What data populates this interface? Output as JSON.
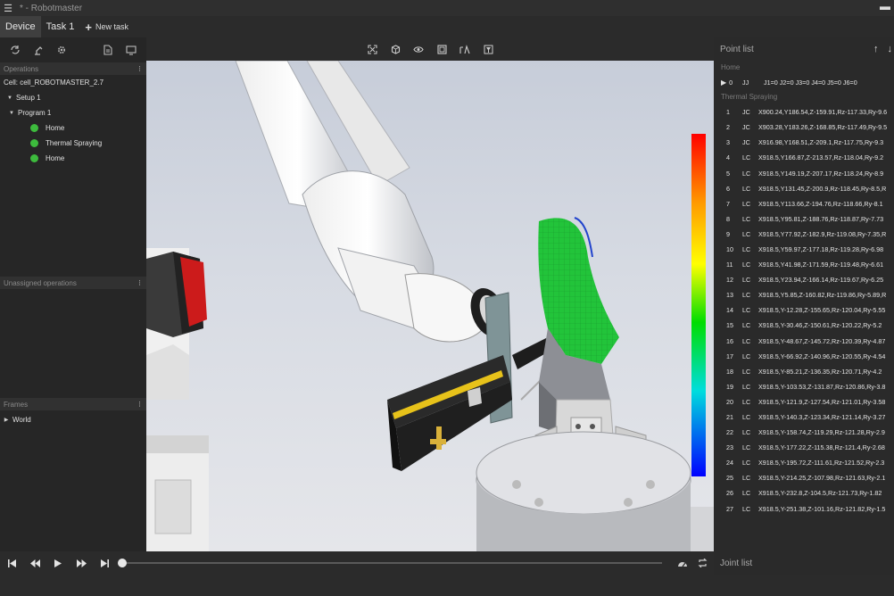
{
  "window": {
    "title": "* - Robotmaster",
    "menu_icon": "hamburger-icon"
  },
  "tabs": [
    {
      "label": "Device",
      "active": true
    },
    {
      "label": "Task 1",
      "active": false
    },
    {
      "label": "New task",
      "icon": "plus-icon",
      "active": false
    }
  ],
  "left_panel": {
    "toolbar_icons": [
      "cycle-icon",
      "robot-arm-icon",
      "gear-icon",
      "document-icon",
      "monitor-icon"
    ],
    "operations": {
      "header": "Operations",
      "cell": "Cell: cell_ROBOTMASTER_2.7",
      "setup": "Setup 1",
      "program": "Program 1",
      "items": [
        {
          "label": "Home",
          "status_color": "#3dbb3d"
        },
        {
          "label": "Thermal Spraying",
          "status_color": "#3dbb3d"
        },
        {
          "label": "Home",
          "status_color": "#3dbb3d"
        }
      ]
    },
    "unassigned": {
      "header": "Unassigned operations"
    },
    "frames": {
      "header": "Frames",
      "items": [
        "World"
      ]
    }
  },
  "viewport_toolbar": [
    "fit-view-icon",
    "cube-view-icon",
    "visibility-icon",
    "frame-icon",
    "path-icon",
    "filter-icon"
  ],
  "colors": {
    "gradient_top": "#ff0000",
    "gradient_bottom": "#0000ff",
    "status_green": "#3dbb3d",
    "panel_bg": "#2a2a2a"
  },
  "point_list": {
    "header": "Point list",
    "home_group": "Home",
    "home_point": {
      "num": "0",
      "type": "JJ",
      "coords": "J1=0 J2=0 J3=0 J4=0 J5=0 J6=0"
    },
    "spray_group": "Thermal Spraying",
    "points": [
      {
        "num": "1",
        "type": "JC",
        "coords": "X900.24,Y186.54,Z-159.91,Rz-117.33,Ry-9.6"
      },
      {
        "num": "2",
        "type": "JC",
        "coords": "X903.28,Y183.26,Z-168.85,Rz-117.49,Ry-9.5"
      },
      {
        "num": "3",
        "type": "JC",
        "coords": "X916.98,Y168.51,Z-209.1,Rz-117.75,Ry-9.3"
      },
      {
        "num": "4",
        "type": "LC",
        "coords": "X918.5,Y166.87,Z-213.57,Rz-118.04,Ry-9.2"
      },
      {
        "num": "5",
        "type": "LC",
        "coords": "X918.5,Y149.19,Z-207.17,Rz-118.24,Ry-8.9"
      },
      {
        "num": "6",
        "type": "LC",
        "coords": "X918.5,Y131.45,Z-200.9,Rz-118.45,Ry-8.5,R"
      },
      {
        "num": "7",
        "type": "LC",
        "coords": "X918.5,Y113.66,Z-194.76,Rz-118.66,Ry-8.1"
      },
      {
        "num": "8",
        "type": "LC",
        "coords": "X918.5,Y95.81,Z-188.76,Rz-118.87,Ry-7.73"
      },
      {
        "num": "9",
        "type": "LC",
        "coords": "X918.5,Y77.92,Z-182.9,Rz-119.08,Ry-7.35,R"
      },
      {
        "num": "10",
        "type": "LC",
        "coords": "X918.5,Y59.97,Z-177.18,Rz-119.28,Ry-6.98"
      },
      {
        "num": "11",
        "type": "LC",
        "coords": "X918.5,Y41.98,Z-171.59,Rz-119.48,Ry-6.61"
      },
      {
        "num": "12",
        "type": "LC",
        "coords": "X918.5,Y23.94,Z-166.14,Rz-119.67,Ry-6.25"
      },
      {
        "num": "13",
        "type": "LC",
        "coords": "X918.5,Y5.85,Z-160.82,Rz-119.86,Ry-5.89,R"
      },
      {
        "num": "14",
        "type": "LC",
        "coords": "X918.5,Y-12.28,Z-155.65,Rz-120.04,Ry-5.55"
      },
      {
        "num": "15",
        "type": "LC",
        "coords": "X918.5,Y-30.46,Z-150.61,Rz-120.22,Ry-5.2"
      },
      {
        "num": "16",
        "type": "LC",
        "coords": "X918.5,Y-48.67,Z-145.72,Rz-120.39,Ry-4.87"
      },
      {
        "num": "17",
        "type": "LC",
        "coords": "X918.5,Y-66.92,Z-140.96,Rz-120.55,Ry-4.54"
      },
      {
        "num": "18",
        "type": "LC",
        "coords": "X918.5,Y-85.21,Z-136.35,Rz-120.71,Ry-4.2"
      },
      {
        "num": "19",
        "type": "LC",
        "coords": "X918.5,Y-103.53,Z-131.87,Rz-120.86,Ry-3.8"
      },
      {
        "num": "20",
        "type": "LC",
        "coords": "X918.5,Y-121.9,Z-127.54,Rz-121.01,Ry-3.58"
      },
      {
        "num": "21",
        "type": "LC",
        "coords": "X918.5,Y-140.3,Z-123.34,Rz-121.14,Ry-3.27"
      },
      {
        "num": "22",
        "type": "LC",
        "coords": "X918.5,Y-158.74,Z-119.29,Rz-121.28,Ry-2.9"
      },
      {
        "num": "23",
        "type": "LC",
        "coords": "X918.5,Y-177.22,Z-115.38,Rz-121.4,Ry-2.68"
      },
      {
        "num": "24",
        "type": "LC",
        "coords": "X918.5,Y-195.72,Z-111.61,Rz-121.52,Ry-2.3"
      },
      {
        "num": "25",
        "type": "LC",
        "coords": "X918.5,Y-214.25,Z-107.98,Rz-121.63,Ry-2.1"
      },
      {
        "num": "26",
        "type": "LC",
        "coords": "X918.5,Y-232.8,Z-104.5,Rz-121.73,Ry-1.82"
      },
      {
        "num": "27",
        "type": "LC",
        "coords": "X918.5,Y-251.38,Z-101.16,Rz-121.82,Ry-1.5"
      }
    ]
  },
  "playback": {
    "buttons": [
      "skip-start-icon",
      "rewind-icon",
      "play-icon",
      "fast-forward-icon",
      "skip-end-icon"
    ],
    "progress": 0.0,
    "speed_icon": "speedometer-icon",
    "loop_icon": "loop-icon"
  },
  "joint_list": {
    "header": "Joint list"
  }
}
